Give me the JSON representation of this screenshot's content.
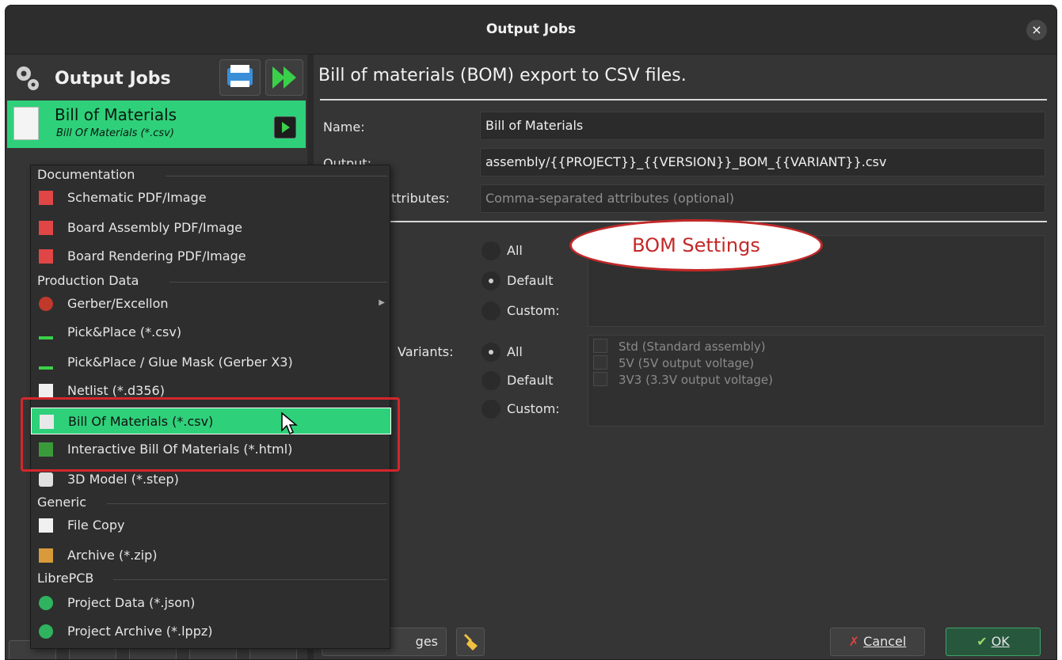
{
  "window": {
    "title": "Output Jobs",
    "close_symbol": "×"
  },
  "left_panel": {
    "header_label": "Output Jobs",
    "job": {
      "title": "Bill of Materials",
      "subtitle": "Bill Of Materials (*.csv)"
    }
  },
  "right_panel": {
    "description": "Bill of materials (BOM) export to CSV files.",
    "fields": {
      "name_label": "Name:",
      "name_value": "Bill of Materials",
      "output_label": "Output:",
      "output_value": "assembly/{{PROJECT}}_{{VERSION}}_BOM_{{VARIANT}}.csv",
      "attributes_label_visible": "ttributes:",
      "attributes_placeholder": "Comma-separated attributes (optional)"
    },
    "boards_radios": [
      "All",
      "Default",
      "Custom:"
    ],
    "boards_selected": "Default",
    "variants_label_visible": "Variants:",
    "variants_radios": [
      "All",
      "Default",
      "Custom:"
    ],
    "variants_selected": "All",
    "variants_list": [
      "Std (Standard assembly)",
      "5V (5V output voltage)",
      "3V3 (3.3V output voltage)"
    ],
    "buttons": {
      "manage_visible": "ges",
      "cancel": "Cancel",
      "ok": "OK"
    }
  },
  "annotation": {
    "bom_settings": "BOM Settings"
  },
  "menu": {
    "sections": [
      {
        "title": "Documentation",
        "items": [
          "Schematic PDF/Image",
          "Board Assembly PDF/Image",
          "Board Rendering PDF/Image"
        ]
      },
      {
        "title": "Production Data",
        "items": [
          "Gerber/Excellon",
          "Pick&Place (*.csv)",
          "Pick&Place / Glue Mask (Gerber X3)",
          "Netlist (*.d356)",
          "Bill Of Materials (*.csv)",
          "Interactive Bill Of Materials (*.html)",
          "3D Model (*.step)"
        ]
      },
      {
        "title": "Generic",
        "items": [
          "File Copy",
          "Archive (*.zip)"
        ]
      },
      {
        "title": "LibrePCB",
        "items": [
          "Project Data (*.json)",
          "Project Archive (*.lppz)"
        ]
      }
    ],
    "active_item": "Bill Of Materials (*.csv)"
  },
  "colors": {
    "accent_green": "#2fd07a",
    "annotation_red": "#c42828"
  }
}
